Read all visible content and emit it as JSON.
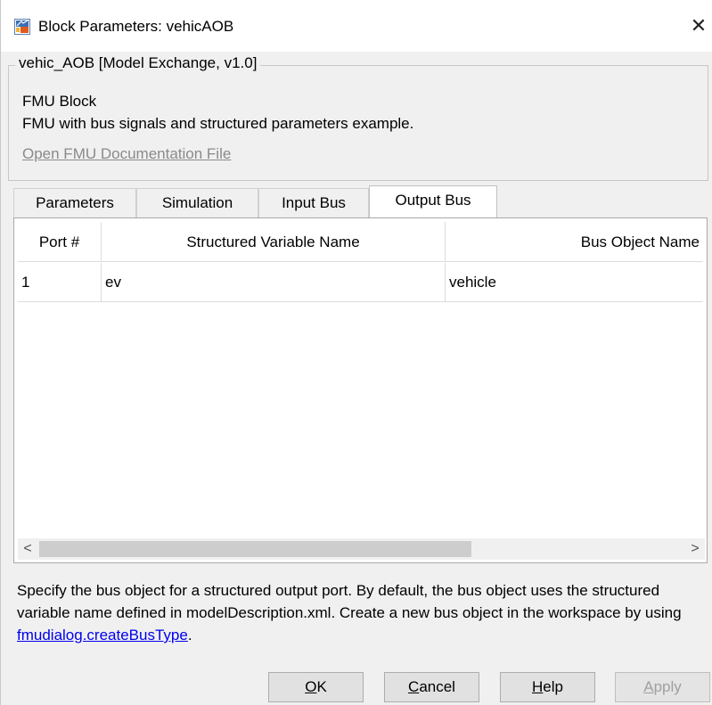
{
  "window": {
    "title": "Block Parameters: vehicAOB",
    "close_glyph": "✕"
  },
  "group": {
    "legend": "vehic_AOB [Model Exchange, v1.0]",
    "block_type": "FMU Block",
    "description": "FMU with bus signals and structured parameters example.",
    "doc_link": "Open FMU Documentation File"
  },
  "tabs": [
    {
      "label": "Parameters",
      "active": false
    },
    {
      "label": "Simulation",
      "active": false
    },
    {
      "label": "Input Bus",
      "active": false
    },
    {
      "label": "Output Bus",
      "active": true
    }
  ],
  "table": {
    "columns": [
      "Port #",
      "Structured Variable Name",
      "Bus Object Name"
    ],
    "rows": [
      [
        "1",
        "ev",
        "vehicle"
      ]
    ]
  },
  "scrollbar": {
    "left_arrow": "<",
    "right_arrow": ">"
  },
  "help": {
    "text_before": "Specify the bus object for a structured output port. By default, the bus object uses the structured variable name defined in modelDescription.xml. Create a new bus object in the workspace by using ",
    "link": "fmudialog.createBusType",
    "text_after": "."
  },
  "buttons": {
    "ok": {
      "mnemonic": "O",
      "rest": "K"
    },
    "cancel": {
      "mnemonic": "C",
      "rest": "ancel"
    },
    "help": {
      "mnemonic": "H",
      "rest": "elp"
    },
    "apply": {
      "mnemonic": "A",
      "rest": "pply"
    }
  },
  "colors": {
    "link_blue": "#0000ee",
    "disabled_gray": "#a0a0a0",
    "dialog_bg": "#f0f0f0"
  },
  "icons": {
    "title_icon": "simulink-block-icon",
    "close_icon": "close-icon"
  }
}
